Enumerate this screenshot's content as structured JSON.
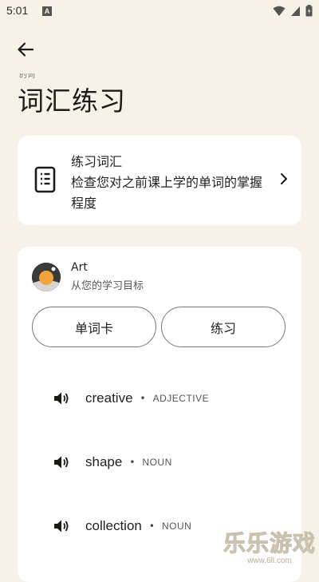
{
  "status_bar": {
    "time": "5:01",
    "notif_icon": "A"
  },
  "header": {
    "partial_text": "的词",
    "title": "词汇练习"
  },
  "practice_card": {
    "title": "练习词汇",
    "description": "检查您对之前课上学的单词的掌握程度",
    "icon": "document-list-icon"
  },
  "vocab_set": {
    "name": "Art",
    "subtitle": "从您的学习目标",
    "buttons": {
      "flashcards": "单词卡",
      "practice": "练习"
    },
    "words": [
      {
        "word": "creative",
        "pos": "ADJECTIVE"
      },
      {
        "word": "shape",
        "pos": "NOUN"
      },
      {
        "word": "collection",
        "pos": "NOUN"
      }
    ]
  },
  "watermark": {
    "main": "乐乐游戏",
    "url": "www.6ll.com"
  },
  "colors": {
    "background": "#f7f2e8",
    "card": "#ffffff",
    "text": "#1d1b18",
    "accent": "#f2a53a"
  }
}
